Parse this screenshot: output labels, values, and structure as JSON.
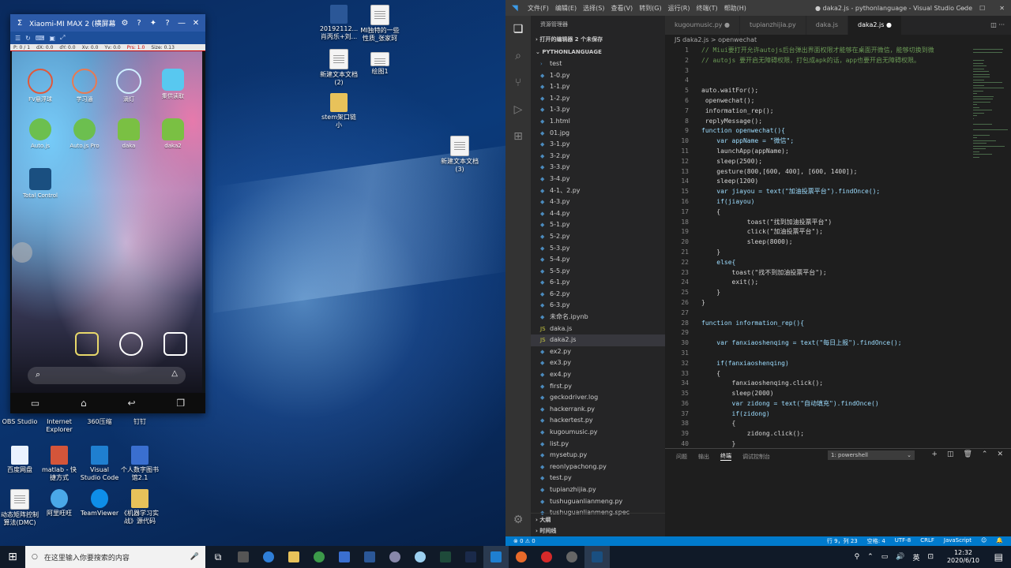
{
  "desktop": {
    "icons": [
      {
        "label": "20192112...\n肖丙乐+刘...",
        "type": "word"
      },
      {
        "label": "MI独特的一些\n性质_张家珂",
        "type": "doc"
      },
      {
        "label": "新建文本文档\n(2)",
        "type": "doc"
      },
      {
        "label": "绘图1",
        "type": "doc"
      },
      {
        "label": "stem架口链\n小",
        "type": "folder"
      },
      {
        "label": "新建文本文档\n(3)",
        "type": "doc"
      },
      {
        "label": "OBS Studio",
        "type": "app"
      },
      {
        "label": "Internet\nExplorer",
        "type": "app"
      },
      {
        "label": "360压缩",
        "type": "app"
      },
      {
        "label": "钉钉",
        "type": "app"
      },
      {
        "label": "百度网盘",
        "type": "app"
      },
      {
        "label": "matlab - 快\n捷方式",
        "type": "app"
      },
      {
        "label": "Visual\nStudio Code",
        "type": "app"
      },
      {
        "label": "个人数字图书\n馆2.1",
        "type": "app"
      },
      {
        "label": "动态矩阵控制\n算法(DMC)",
        "type": "doc"
      },
      {
        "label": "阿里旺旺",
        "type": "app"
      },
      {
        "label": "TeamViewer",
        "type": "app"
      },
      {
        "label": "《机器学习实\n战》源代码",
        "type": "folder"
      }
    ]
  },
  "phone": {
    "title": "Xiaomi-MI MAX 2 (横屏幕)",
    "status_items": [
      "P: 0 / 1",
      "dX: 0.0",
      "dY: 0.0",
      "Xv: 0.0",
      "Yv: 0.0",
      "Prs: 1.0",
      "Size: 0.13"
    ],
    "apps": [
      {
        "label": "FV悬浮球",
        "color": "#e0583a"
      },
      {
        "label": "学习通",
        "color": "#e87a52"
      },
      {
        "label": "滴灯",
        "color": "#8ed0f0"
      },
      {
        "label": "集供读取",
        "color": "#58c8f0"
      },
      {
        "label": "Auto.js",
        "color": "#6cbf4f"
      },
      {
        "label": "Auto.js Pro",
        "color": "#6cbf4f"
      },
      {
        "label": "daka",
        "color": "#7ac043"
      },
      {
        "label": "daka2",
        "color": "#7ac043"
      },
      {
        "label": "Total Control",
        "color": "#1a4f80"
      }
    ]
  },
  "vscode": {
    "menu": [
      "文件(F)",
      "编辑(E)",
      "选择(S)",
      "查看(V)",
      "转到(G)",
      "运行(R)",
      "终端(T)",
      "帮助(H)"
    ],
    "window_title": "● daka2.js - pythonlanguage - Visual Studio Code",
    "explorer_title": "资源管理器",
    "open_editors": "打开的编辑器  2 个未保存",
    "project": "PYTHONLANGUAGE",
    "files": [
      {
        "name": "test",
        "type": "folder"
      },
      {
        "name": "1-0.py",
        "type": "py"
      },
      {
        "name": "1-1.py",
        "type": "py"
      },
      {
        "name": "1-2.py",
        "type": "py"
      },
      {
        "name": "1-3.py",
        "type": "py"
      },
      {
        "name": "1.html",
        "type": "html"
      },
      {
        "name": "01.jpg",
        "type": "img"
      },
      {
        "name": "3-1.py",
        "type": "py"
      },
      {
        "name": "3-2.py",
        "type": "py"
      },
      {
        "name": "3-3.py",
        "type": "py"
      },
      {
        "name": "3-4.py",
        "type": "py"
      },
      {
        "name": "4-1、2.py",
        "type": "py"
      },
      {
        "name": "4-3.py",
        "type": "py"
      },
      {
        "name": "4-4.py",
        "type": "py"
      },
      {
        "name": "5-1.py",
        "type": "py"
      },
      {
        "name": "5-2.py",
        "type": "py"
      },
      {
        "name": "5-3.py",
        "type": "py"
      },
      {
        "name": "5-4.py",
        "type": "py"
      },
      {
        "name": "5-5.py",
        "type": "py"
      },
      {
        "name": "6-1.py",
        "type": "py"
      },
      {
        "name": "6-2.py",
        "type": "py"
      },
      {
        "name": "6-3.py",
        "type": "py"
      },
      {
        "name": "未命名.ipynb",
        "type": "nb"
      },
      {
        "name": "daka.js",
        "type": "js"
      },
      {
        "name": "daka2.js",
        "type": "js",
        "selected": true
      },
      {
        "name": "ex2.py",
        "type": "py"
      },
      {
        "name": "ex3.py",
        "type": "py"
      },
      {
        "name": "ex4.py",
        "type": "py"
      },
      {
        "name": "first.py",
        "type": "py"
      },
      {
        "name": "geckodriver.log",
        "type": "log"
      },
      {
        "name": "hackerrank.py",
        "type": "py"
      },
      {
        "name": "hackertest.py",
        "type": "py"
      },
      {
        "name": "kugoumusic.py",
        "type": "py"
      },
      {
        "name": "list.py",
        "type": "py"
      },
      {
        "name": "mysetup.py",
        "type": "py"
      },
      {
        "name": "reonlypachong.py",
        "type": "py"
      },
      {
        "name": "test.py",
        "type": "py"
      },
      {
        "name": "tupianzhijia.py",
        "type": "py"
      },
      {
        "name": "tushuguanlianmeng.py",
        "type": "py"
      },
      {
        "name": "tushuguanlianmeng.spec",
        "type": "spec"
      }
    ],
    "outline": "大纲",
    "timeline": "时间线",
    "tabs": [
      {
        "label": "kugoumusic.py",
        "active": false
      },
      {
        "label": "tupianzhijia.py",
        "active": false
      },
      {
        "label": "daka.js",
        "active": false
      },
      {
        "label": "daka2.js",
        "active": true
      }
    ],
    "breadcrumb": "JS daka2.js > openwechat",
    "code": [
      "// Miui要打开允许autojs后台弹出界面权限才能够在桌面开微信，能够切换到微",
      "// autojs 要开启无障碍权限，打包成apk的话，app也要开启无障碍权限。",
      "",
      "",
      "auto.waitFor();",
      " openwechat();",
      " information_rep();",
      " replyMessage();",
      "function openwechat(){",
      "    var appName = \"微信\";",
      "    launchApp(appName);",
      "    sleep(2500);",
      "    gesture(800,[600, 400], [600, 1400]);",
      "    sleep(1200)",
      "    var jiayou = text(\"加油投票平台\").findOnce();",
      "    if(jiayou)",
      "    {",
      "            toast(\"找到加油投票平台\")",
      "            click(\"加油投票平台\");",
      "            sleep(8000);",
      "    }",
      "    else{",
      "        toast(\"找不到加油投票平台\");",
      "        exit();",
      "    }",
      "}",
      "",
      "function information_rep(){",
      "",
      "    var fanxiaoshenqing = text(\"每日上报\").findOnce();",
      "",
      "    if(fanxiaoshenqing)",
      "    {",
      "        fanxiaoshenqing.click();",
      "        sleep(2000)",
      "        var zidong = text(\"自动填充\").findOnce()",
      "        if(zidong)",
      "        {",
      "            zidong.click();",
      "        }"
    ],
    "panel_tabs": [
      "问题",
      "输出",
      "终端",
      "调试控制台"
    ],
    "shell": "1: powershell",
    "status_left": "⊗ 0 ⚠ 0",
    "status_right": [
      "行 9，列 23",
      "空格: 4",
      "UTF-8",
      "CRLF",
      "JavaScript"
    ]
  },
  "taskbar": {
    "search_placeholder": "在这里输入你要搜索的内容",
    "time": "12:32",
    "date": "2020/6/10",
    "ime": "英"
  }
}
